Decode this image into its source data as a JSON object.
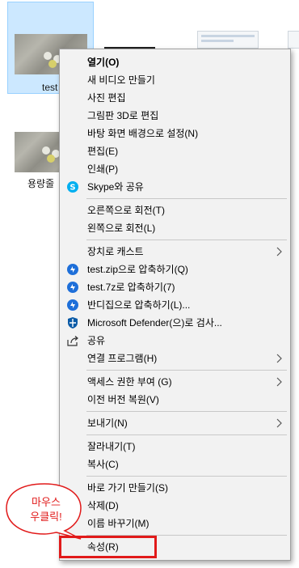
{
  "desktop": {
    "files": [
      {
        "label": "test"
      },
      {
        "label": "용량줄"
      }
    ]
  },
  "context_menu": {
    "groups": [
      [
        {
          "label": "열기(O)",
          "bold": true,
          "icon": null
        },
        {
          "label": "새 비디오 만들기",
          "icon": null
        },
        {
          "label": "사진 편집",
          "icon": null
        },
        {
          "label": "그림판 3D로 편집",
          "icon": null
        },
        {
          "label": "바탕 화면 배경으로 설정(N)",
          "icon": null
        },
        {
          "label": "편집(E)",
          "icon": null
        },
        {
          "label": "인쇄(P)",
          "icon": null
        },
        {
          "label": "Skype와 공유",
          "icon": "skype-icon"
        }
      ],
      [
        {
          "label": "오른쪽으로 회전(T)",
          "icon": null
        },
        {
          "label": "왼쪽으로 회전(L)",
          "icon": null
        }
      ],
      [
        {
          "label": "장치로 캐스트",
          "icon": null,
          "submenu": true
        },
        {
          "label": "test.zip으로 압축하기(Q)",
          "icon": "bandizip-icon"
        },
        {
          "label": "test.7z로 압축하기(7)",
          "icon": "bandizip-icon"
        },
        {
          "label": "반디집으로 압축하기(L)...",
          "icon": "bandizip-icon"
        },
        {
          "label": "Microsoft Defender(으)로 검사...",
          "icon": "defender-shield-icon"
        },
        {
          "label": "공유",
          "icon": "share-icon"
        },
        {
          "label": "연결 프로그램(H)",
          "icon": null,
          "submenu": true
        }
      ],
      [
        {
          "label": "액세스 권한 부여 (G)",
          "icon": null,
          "submenu": true
        },
        {
          "label": "이전 버전 복원(V)",
          "icon": null
        }
      ],
      [
        {
          "label": "보내기(N)",
          "icon": null,
          "submenu": true
        }
      ],
      [
        {
          "label": "잘라내기(T)",
          "icon": null
        },
        {
          "label": "복사(C)",
          "icon": null
        }
      ],
      [
        {
          "label": "바로 가기 만들기(S)",
          "icon": null
        },
        {
          "label": "삭제(D)",
          "icon": null
        },
        {
          "label": "이름 바꾸기(M)",
          "icon": null
        }
      ],
      [
        {
          "label": "속성(R)",
          "icon": null
        }
      ]
    ]
  },
  "annotation": {
    "line1": "마우스",
    "line2": "우클릭!",
    "color": "#e11a1a"
  },
  "colors": {
    "menu_bg": "#f2f2f2",
    "selection_bg": "#cce8ff",
    "highlight": "#e11a1a"
  }
}
